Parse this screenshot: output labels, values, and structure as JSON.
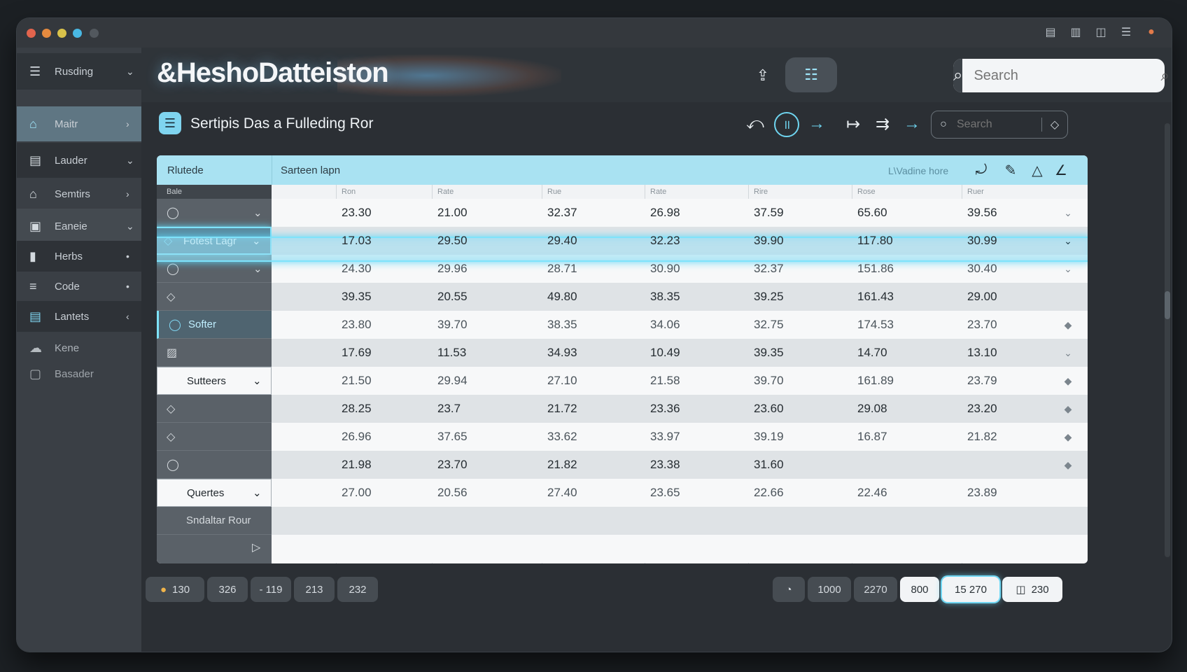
{
  "window_controls": {
    "dots": [
      "#e2644d",
      "#e58a3f",
      "#d9c24a",
      "#49b8e3",
      "#52585e"
    ],
    "titlebar_icons": [
      "window-icon",
      "window-icon",
      "panel-icon",
      "menu-icon",
      "record-icon"
    ]
  },
  "sidebar": {
    "top_menu": {
      "label": "Rusding",
      "icon": "menu-icon",
      "arrow": "⌄"
    },
    "items": [
      {
        "label": "Maitr",
        "icon": "home-icon",
        "arrow": "›"
      },
      {
        "label": "Lauder",
        "icon": "list-icon",
        "arrow": "⌄"
      },
      {
        "label": "Semtirs",
        "icon": "home-icon",
        "arrow": "›"
      },
      {
        "label": "Eaneie",
        "icon": "box-icon",
        "arrow": "⌄"
      },
      {
        "label": "Herbs",
        "icon": "book-icon",
        "arrow": "•"
      },
      {
        "label": "Code",
        "icon": "lines-icon",
        "arrow": "•"
      },
      {
        "label": "Lantets",
        "icon": "list-icon",
        "arrow": "‹"
      },
      {
        "label": "Kene",
        "icon": "cloud-icon",
        "arrow": ""
      },
      {
        "label": "Basader",
        "icon": "box-icon",
        "arrow": ""
      }
    ]
  },
  "header": {
    "brand": "&HeshoDatteiston",
    "search_placeholder": "Search"
  },
  "toolbar": {
    "title": "Sertipis Das a Fulleding Ror",
    "search_placeholder": "Search"
  },
  "table": {
    "top_left": "Rlutede",
    "top_mid": "Sarteen lapn",
    "top_right": "L\\Vadine hore",
    "left_header": "Bale",
    "columns": [
      "Ron",
      "Rate",
      "Rue",
      "Rate",
      "Rire",
      "Rose",
      "Ruer"
    ],
    "left_rows": [
      {
        "label": "",
        "icon": "circle-icon",
        "arrow": "⌄",
        "style": ""
      },
      {
        "label": "Fotest Lagr",
        "icon": "diamond-icon",
        "arrow": "⌄",
        "style": "hl"
      },
      {
        "label": "",
        "icon": "circle-icon",
        "arrow": "⌄",
        "style": ""
      },
      {
        "label": "",
        "icon": "diamond-icon",
        "arrow": "",
        "style": ""
      },
      {
        "label": "Softer",
        "icon": "circle-icon",
        "arrow": "",
        "style": "hl"
      },
      {
        "label": "",
        "icon": "image-icon",
        "arrow": "",
        "style": ""
      },
      {
        "label": "Sutteers",
        "icon": "",
        "arrow": "⌄",
        "style": "white"
      },
      {
        "label": "",
        "icon": "diamond-icon",
        "arrow": "",
        "style": ""
      },
      {
        "label": "",
        "icon": "diamond-icon",
        "arrow": "",
        "style": ""
      },
      {
        "label": "",
        "icon": "circle-icon",
        "arrow": "",
        "style": ""
      },
      {
        "label": "Quertes",
        "icon": "",
        "arrow": "⌄",
        "style": "white"
      },
      {
        "label": "Sndaltar Rour",
        "icon": "",
        "arrow": "",
        "style": ""
      }
    ],
    "rows": [
      [
        "23.30",
        "21.00",
        "32.37",
        "26.98",
        "37.59",
        "65.60",
        "39.56"
      ],
      [
        "17.03",
        "29.50",
        "29.40",
        "32.23",
        "39.90",
        "117.80",
        "30.99"
      ],
      [
        "24.30",
        "29.96",
        "28.71",
        "30.90",
        "32.37",
        "151.86",
        "30.40"
      ],
      [
        "39.35",
        "20.55",
        "49.80",
        "38.35",
        "39.25",
        "161.43",
        "29.00"
      ],
      [
        "23.80",
        "39.70",
        "38.35",
        "34.06",
        "32.75",
        "174.53",
        "23.70"
      ],
      [
        "17.69",
        "11.53",
        "34.93",
        "10.49",
        "39.35",
        "14.70",
        "13.10"
      ],
      [
        "21.50",
        "29.94",
        "27.10",
        "21.58",
        "39.70",
        "161.89",
        "23.79"
      ],
      [
        "28.25",
        "23.7",
        "21.72",
        "23.36",
        "23.60",
        "29.08",
        "23.20"
      ],
      [
        "26.96",
        "37.65",
        "33.62",
        "33.97",
        "39.19",
        "16.87",
        "21.82"
      ],
      [
        "21.98",
        "23.70",
        "21.82",
        "23.38",
        "31.60",
        "",
        ""
      ],
      [
        "27.00",
        "20.56",
        "27.40",
        "23.65",
        "22.66",
        "22.46",
        "23.89"
      ]
    ],
    "row_arrows": [
      "⌄",
      "⌄",
      "⌄",
      "",
      "◆",
      "⌄",
      "◆",
      "◆",
      "◆",
      "◆",
      ""
    ]
  },
  "footer": {
    "left_pages": [
      "130",
      "326",
      "- 119",
      "213",
      "232"
    ],
    "right_pages": [
      "1000",
      "2270",
      "800",
      "15 270",
      "230"
    ]
  },
  "colors": {
    "accent": "#7fd4ef",
    "highlight_glow": "#5fd7f7"
  }
}
